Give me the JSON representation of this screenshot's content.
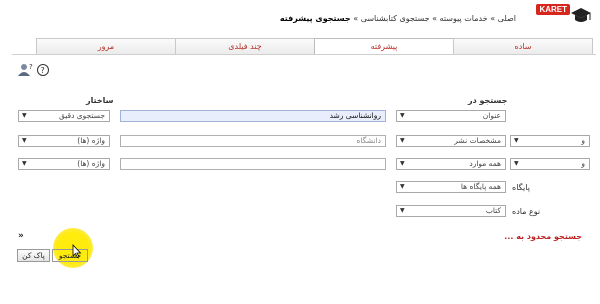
{
  "header": {
    "logo_text": "KARET",
    "breadcrumb": [
      "اصلی",
      "خدمات پیوسته",
      "جستجوی کتابشناسی"
    ],
    "breadcrumb_sep": "»",
    "breadcrumb_current": "جستجوی پیشرفته"
  },
  "tabs": [
    {
      "label": "ساده",
      "active": false
    },
    {
      "label": "پیشرفته",
      "active": true
    },
    {
      "label": "چند فیلدی",
      "active": false
    },
    {
      "label": "مرور",
      "active": false
    }
  ],
  "labels": {
    "search_in": "جستجو در",
    "structure": "ساختار",
    "database": "پایگاه",
    "material_type": "نوع ماده",
    "limit": "جستجو محدود به ..."
  },
  "rows": [
    {
      "connector": "",
      "field": "عنوان",
      "query": "روانشناسی رشد",
      "query_placeholder": "",
      "structure": "جستجوی دقیق"
    },
    {
      "connector": "و",
      "field": "مشخصات نشر",
      "query": "",
      "query_placeholder": "دانشگاه",
      "structure": "واژه (ها)"
    },
    {
      "connector": "و",
      "field": "همه موارد",
      "query": "",
      "query_placeholder": "",
      "structure": "واژه (ها)"
    }
  ],
  "filters": {
    "database_value": "همه پایگاه ها",
    "material_type_value": "کتاب"
  },
  "buttons": {
    "clear": "پاک کن",
    "search": "جستجو"
  },
  "colors": {
    "tab_text": "#b8322a",
    "limit_text": "#b22222",
    "highlight_input": "#e8eefb",
    "cursor_highlight": "#ffeb00"
  },
  "icons": {
    "help": "help-icon",
    "user_question": "user-question-icon",
    "expand": "double-chevron-down-icon",
    "cursor": "mouse-pointer-icon"
  }
}
